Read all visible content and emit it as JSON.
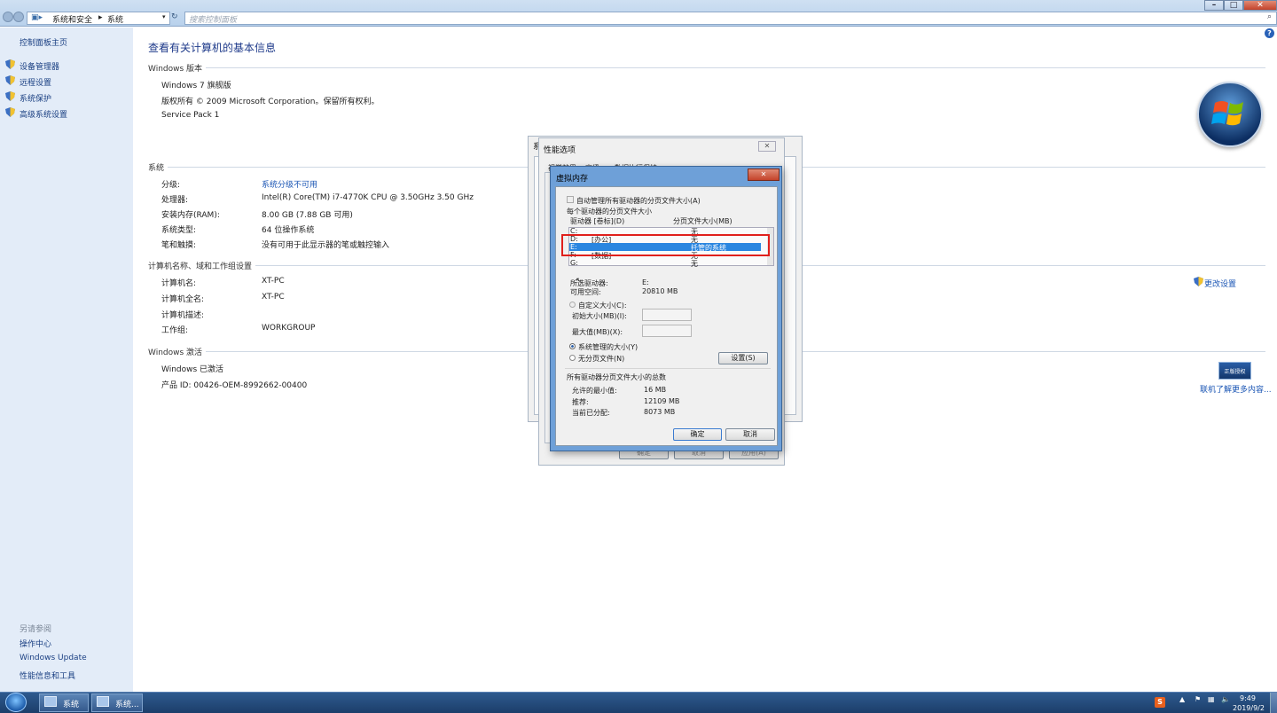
{
  "address": {
    "crumb1": "系统和安全",
    "crumb2": "系统"
  },
  "search": {
    "placeholder": "搜索控制面板"
  },
  "sidebar": {
    "home": "控制面板主页",
    "items": [
      {
        "label": "设备管理器"
      },
      {
        "label": "远程设置"
      },
      {
        "label": "系统保护"
      },
      {
        "label": "高级系统设置"
      }
    ],
    "seealso": "另请参阅",
    "links": [
      {
        "label": "操作中心"
      },
      {
        "label": "Windows Update"
      },
      {
        "label": "性能信息和工具"
      }
    ]
  },
  "main": {
    "title": "查看有关计算机的基本信息",
    "edition": {
      "header": "Windows 版本",
      "name": "Windows 7 旗舰版",
      "copyright": "版权所有 © 2009 Microsoft Corporation。保留所有权利。",
      "sp": "Service Pack 1"
    },
    "system": {
      "header": "系统",
      "rows": [
        {
          "label": "分级:",
          "value": "系统分级不可用"
        },
        {
          "label": "处理器:",
          "value": "Intel(R) Core(TM) i7-4770K CPU @ 3.50GHz   3.50 GHz"
        },
        {
          "label": "安装内存(RAM):",
          "value": "8.00 GB (7.88 GB 可用)"
        },
        {
          "label": "系统类型:",
          "value": "64 位操作系统"
        },
        {
          "label": "笔和触摸:",
          "value": "没有可用于此显示器的笔或触控输入"
        }
      ]
    },
    "computer": {
      "header": "计算机名称、域和工作组设置",
      "rows": [
        {
          "label": "计算机名:",
          "value": "XT-PC"
        },
        {
          "label": "计算机全名:",
          "value": "XT-PC"
        },
        {
          "label": "计算机描述:",
          "value": ""
        },
        {
          "label": "工作组:",
          "value": "WORKGROUP"
        }
      ],
      "change": "更改设置"
    },
    "activation": {
      "header": "Windows 激活",
      "status": "Windows 已激活",
      "productid": "产品 ID: 00426-OEM-8992662-00400",
      "learnmore": "联机了解更多内容...",
      "badge": "正版授权"
    }
  },
  "dialogs": {
    "sysprops": {
      "title": "系"
    },
    "perf": {
      "title": "性能选项",
      "tabs": [
        "视觉效果",
        "高级",
        "数据执行保护"
      ],
      "ok": "确定",
      "cancel": "取消",
      "apply": "应用(A)"
    },
    "vm": {
      "title": "虚拟内存",
      "auto": "自动管理所有驱动器的分页文件大小(A)",
      "each": "每个驱动器的分页文件大小",
      "col_drive": "驱动器 [卷标](D)",
      "col_size": "分页文件大小(MB)",
      "drives": [
        {
          "drive": "C:",
          "label": "",
          "size": "无"
        },
        {
          "drive": "D:",
          "label": "[办公]",
          "size": "无"
        },
        {
          "drive": "E:",
          "label": "",
          "size": "托管的系统"
        },
        {
          "drive": "F:",
          "label": "[数据]",
          "size": "无"
        },
        {
          "drive": "G:",
          "label": "",
          "size": "无"
        }
      ],
      "sel_label": "所选驱动器:",
      "sel_value": "E:",
      "free_label": "可用空间:",
      "free_value": "20810 MB",
      "custom": "自定义大小(C):",
      "initial": "初始大小(MB)(I):",
      "max": "最大值(MB)(X):",
      "sysmanaged": "系统管理的大小(Y)",
      "nopage": "无分页文件(N)",
      "set": "设置(S)",
      "total": "所有驱动器分页文件大小的总数",
      "min_label": "允许的最小值:",
      "min_value": "16 MB",
      "rec_label": "推荐:",
      "rec_value": "12109 MB",
      "cur_label": "当前已分配:",
      "cur_value": "8073 MB",
      "ok": "确定",
      "cancel": "取消"
    }
  },
  "taskbar": {
    "item1": "系统",
    "item2": "系统...",
    "time": "9:49",
    "date": "2019/9/2"
  }
}
